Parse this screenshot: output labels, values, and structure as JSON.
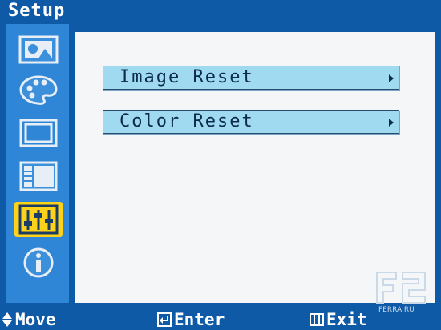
{
  "header": {
    "title": "Setup"
  },
  "sidebar": {
    "tabs": [
      {
        "icon": "picture-icon",
        "active": false
      },
      {
        "icon": "palette-icon",
        "active": false
      },
      {
        "icon": "screen-geometry-icon",
        "active": false
      },
      {
        "icon": "osd-layout-icon",
        "active": false
      },
      {
        "icon": "sliders-icon",
        "active": true
      },
      {
        "icon": "info-icon",
        "active": false
      }
    ]
  },
  "menu": {
    "items": [
      {
        "label": "Image Reset"
      },
      {
        "label": "Color Reset"
      }
    ]
  },
  "footer": {
    "move_label": "Move",
    "enter_label": "Enter",
    "exit_label": "Exit"
  },
  "watermark": {
    "text": "FERRA.RU"
  },
  "colors": {
    "frame": "#0e5aa7",
    "sidebar": "#2f86d6",
    "active_tab": "#ffd21a",
    "content_bg": "#f5f6f7",
    "menu_item_bg": "#9fdaf1"
  }
}
